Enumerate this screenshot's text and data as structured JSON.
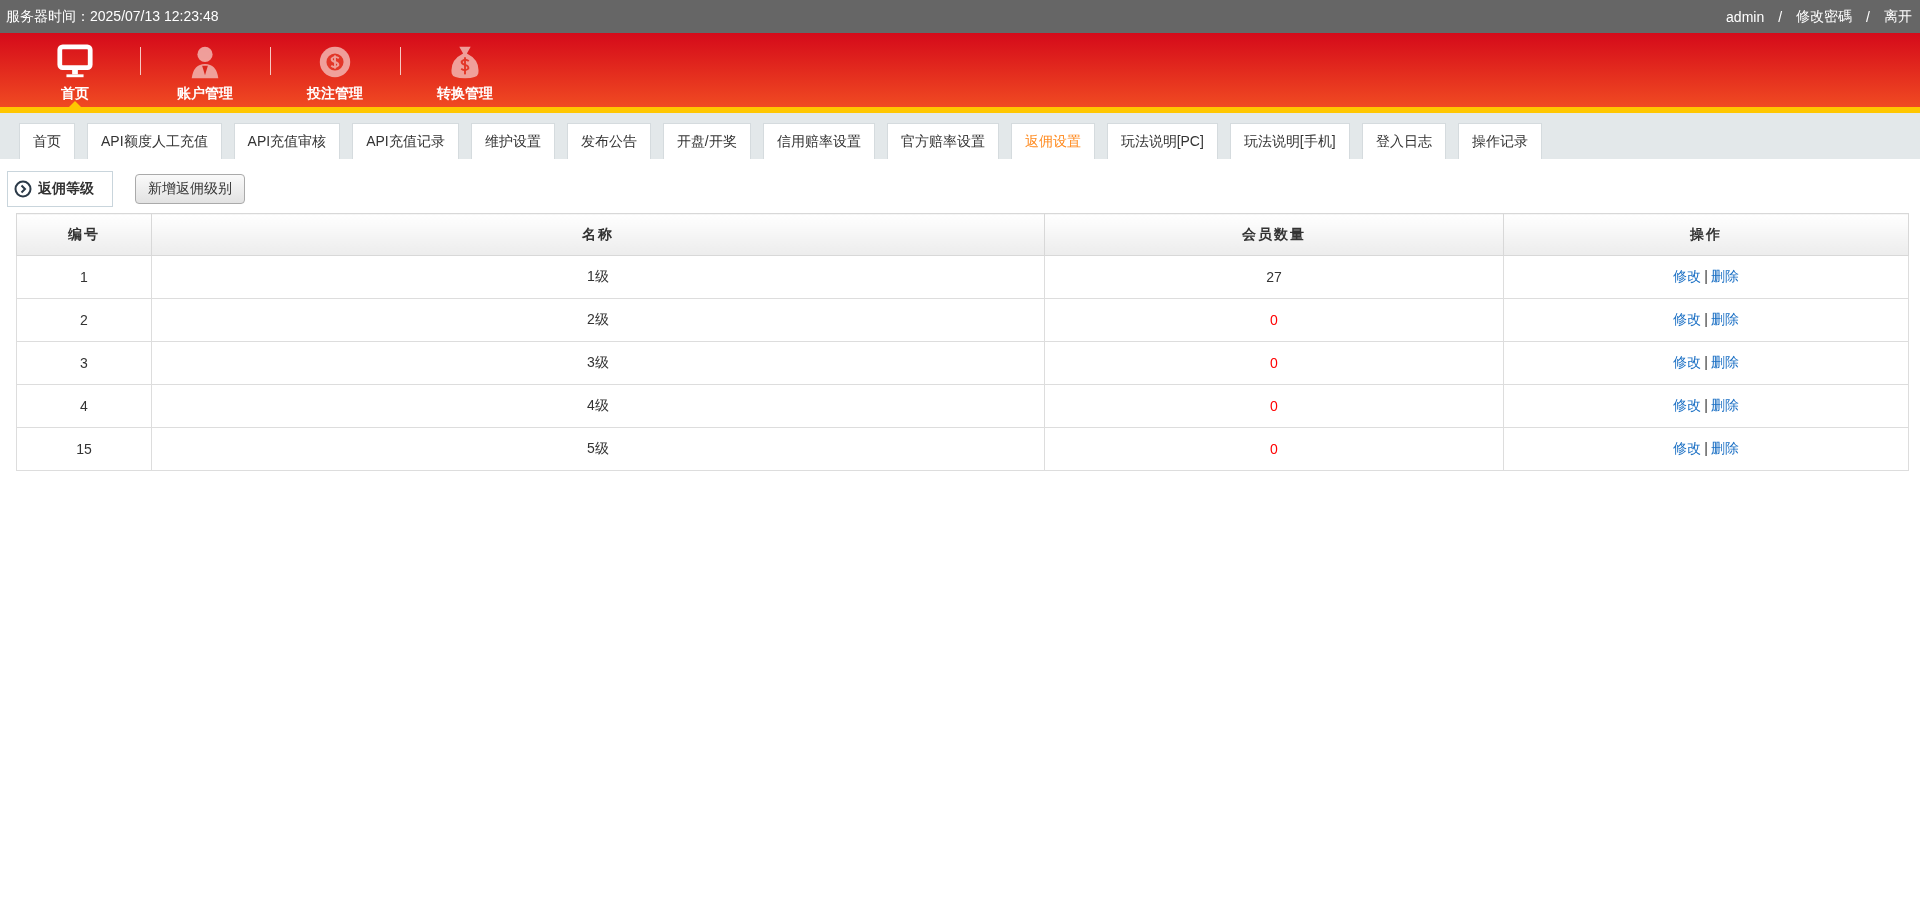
{
  "top_bar": {
    "server_time_label": "服务器时间：",
    "server_time": "2025/07/13 12:23:48",
    "user": "admin",
    "links": [
      {
        "label": "修改密碼"
      },
      {
        "label": "离开"
      }
    ],
    "separator": "/"
  },
  "main_nav": [
    {
      "label": "首页",
      "selected": true
    },
    {
      "label": "账户管理",
      "selected": false
    },
    {
      "label": "投注管理",
      "selected": false
    },
    {
      "label": "转换管理",
      "selected": false
    }
  ],
  "tabs": [
    {
      "label": "首页",
      "selected": false
    },
    {
      "label": "API额度人工充值",
      "selected": false
    },
    {
      "label": "API充值审核",
      "selected": false
    },
    {
      "label": "API充值记录",
      "selected": false
    },
    {
      "label": "维护设置",
      "selected": false
    },
    {
      "label": "发布公告",
      "selected": false
    },
    {
      "label": "开盘/开奖",
      "selected": false
    },
    {
      "label": "信用赔率设置",
      "selected": false
    },
    {
      "label": "官方赔率设置",
      "selected": false
    },
    {
      "label": "返佣设置",
      "selected": true
    },
    {
      "label": "玩法说明[PC]",
      "selected": false
    },
    {
      "label": "玩法说明[手机]",
      "selected": false
    },
    {
      "label": "登入日志",
      "selected": false
    },
    {
      "label": "操作记录",
      "selected": false
    }
  ],
  "section": {
    "title": "返佣等级",
    "add_button": "新增返佣级别"
  },
  "table": {
    "columns": [
      "编号",
      "名称",
      "会员数量",
      "操作"
    ],
    "action_separator": "|",
    "rows": [
      {
        "id": "1",
        "name": "1级",
        "members": "27",
        "color": "#333333",
        "actions": [
          "修改",
          "删除"
        ]
      },
      {
        "id": "2",
        "name": "2级",
        "members": "0",
        "color": "#ff0000",
        "actions": [
          "修改",
          "删除"
        ]
      },
      {
        "id": "3",
        "name": "3级",
        "members": "0",
        "color": "#ff0000",
        "actions": [
          "修改",
          "删除"
        ]
      },
      {
        "id": "4",
        "name": "4级",
        "members": "0",
        "color": "#ff0000",
        "actions": [
          "修改",
          "删除"
        ]
      },
      {
        "id": "15",
        "name": "5级",
        "members": "0",
        "color": "#ff0000",
        "actions": [
          "修改",
          "删除"
        ]
      }
    ]
  }
}
